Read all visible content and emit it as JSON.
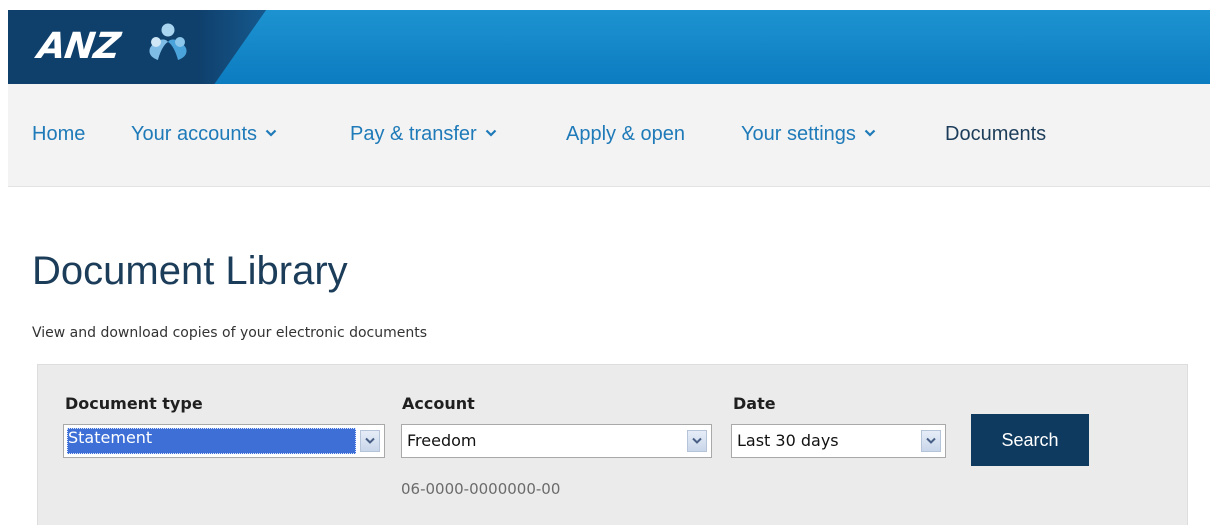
{
  "brand": {
    "name": "ANZ",
    "colors": {
      "header_blue": "#1290d0",
      "brand_navy": "#0f3f6b",
      "nav_link": "#1e7ab8",
      "title": "#1c3d5a",
      "button": "#0f3a5f"
    }
  },
  "nav": {
    "items": [
      {
        "label": "Home",
        "has_dropdown": false
      },
      {
        "label": "Your accounts",
        "has_dropdown": true,
        "icon": "chevron-down-icon"
      },
      {
        "label": "Pay & transfer",
        "has_dropdown": true,
        "icon": "chevron-down-icon"
      },
      {
        "label": "Apply & open",
        "has_dropdown": false
      },
      {
        "label": "Your settings",
        "has_dropdown": true,
        "icon": "chevron-down-icon"
      },
      {
        "label": "Documents",
        "has_dropdown": false,
        "current": true
      }
    ]
  },
  "page": {
    "title": "Document Library",
    "subtitle": "View and download copies of your electronic documents"
  },
  "filters": {
    "document_type": {
      "label": "Document type",
      "value": "Statement"
    },
    "account": {
      "label": "Account",
      "value": "Freedom",
      "number": "06-0000-0000000-00"
    },
    "date": {
      "label": "Date",
      "value": "Last 30 days"
    },
    "search_label": "Search"
  }
}
